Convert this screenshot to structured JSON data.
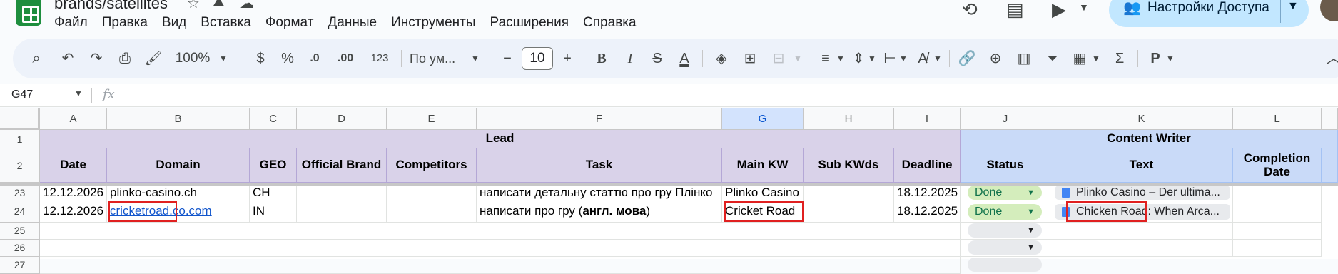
{
  "app": {
    "title": "brands/satellites",
    "menu": [
      "Файл",
      "Правка",
      "Вид",
      "Вставка",
      "Формат",
      "Данные",
      "Инструменты",
      "Расширения",
      "Справка"
    ],
    "share_label": "Настройки Доступа"
  },
  "toolbar": {
    "zoom": "100%",
    "currency": "$",
    "percent": "%",
    "decrease_decimals": ".0",
    "increase_decimals": ".00",
    "number_format": "123",
    "font_name": "По ум...",
    "font_size": "10",
    "bold": "B",
    "italic": "I",
    "strike": "S",
    "text_color": "A",
    "rtl": "P"
  },
  "formula_bar": {
    "namebox": "G47",
    "fx": "fx"
  },
  "columns": [
    "A",
    "B",
    "C",
    "D",
    "E",
    "F",
    "G",
    "H",
    "I",
    "J",
    "K",
    "L"
  ],
  "header_rows": {
    "row1_numbers": "1",
    "row2_numbers": "2",
    "group_lead": "Lead",
    "group_content_writer": "Content Writer",
    "labels": [
      "Date",
      "Domain",
      "GEO",
      "Official Brand",
      "Competitors",
      "Task",
      "Main KW",
      "Sub KWds",
      "Deadline",
      "Status",
      "Text",
      "Completion Date"
    ]
  },
  "rows": [
    {
      "num": "23",
      "date": "12.12.2026",
      "domain": "plinko-casino.ch",
      "geo": "CH",
      "task": "написати детальну статтю про гру Плінко",
      "main_kw": "Plinko Casino",
      "deadline": "18.12.2025",
      "status": "Done",
      "text": "Plinko Casino – Der ultima..."
    },
    {
      "num": "24",
      "date": "12.12.2026",
      "domain": "cricketroad.co.com",
      "geo": "IN",
      "task_prefix": "написати про гру (",
      "task_bold": "англ. мова",
      "task_suffix": ")",
      "main_kw": "Cricket Road",
      "deadline": "18.12.2025",
      "status": "Done",
      "text": "Chicken Road: When Arca..."
    },
    {
      "num": "25"
    },
    {
      "num": "26"
    },
    {
      "num": "27"
    }
  ],
  "colors": {
    "lead_header": "#d9d2e9",
    "content_writer_header": "#c9daf8",
    "status_done": "#d4edbc",
    "highlight_box": "#e02020",
    "share_button": "#c2e7ff"
  }
}
